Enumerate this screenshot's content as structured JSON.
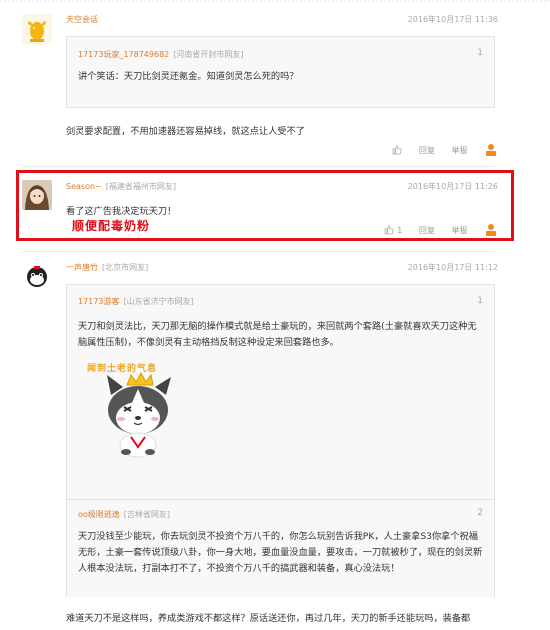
{
  "comments": [
    {
      "username": "天空会话",
      "location": "",
      "time": "2016年10月17日 11:36",
      "quote": {
        "username": "17173玩家_178749682",
        "location": "[河南省开封市网友]",
        "floor": "1",
        "text": "讲个笑话：天刀比剑灵还氪金。知道剑灵怎么死的吗？"
      },
      "text": "剑灵要求配置，不用加速器还容易掉线，就这点让人受不了",
      "actions": {
        "like_count": "",
        "reply": "回复",
        "report": "举报"
      }
    },
    {
      "username": "Season~",
      "location": "[福建省福州市网友]",
      "time": "2016年10月17日 11:26",
      "text": "看了这广告我决定玩天刀！",
      "actions": {
        "like_count": "1",
        "reply": "回复",
        "report": "举报"
      },
      "annotation": "顺便配毒奶粉"
    },
    {
      "username": "一声唐竹",
      "location": "[北京市网友]",
      "time": "2016年10月17日 11:12",
      "quote": {
        "username": "17173游客",
        "location": "[山东省济宁市网友]",
        "floor": "1",
        "text": "天刀和剑灵法比，天刀那无脑的操作模式就是给土豪玩的，来回就两个套路(土豪就喜欢天刀这种无脑属性压制)，不像剑灵有主动格挡反制这种设定来回套路也多。",
        "sticker_caption": "闻到土老的气息"
      },
      "quote2": {
        "username": "oo极限逃逸",
        "location": "[吉林省网友]",
        "floor": "2",
        "text": "天刀没钱至少能玩，你去玩剑灵不投资个万八千的，你怎么玩别告诉我PK，人土豪拿S3你拿个祝福无形，土豪一套传说顶级八卦，你一身大地，要血量没血量，要攻击，一刀就被秒了，现在的剑灵新人根本没法玩，打副本打不了，不投资个万八千的搞武器和装备，真心没法玩！"
      },
      "text": "难道天刀不是这样吗，养成类游戏不都这样？原话送还你，再过几年，天刀的新手还能玩吗，装备都"
    }
  ],
  "colors": {
    "username": "#e07b27",
    "muted": "#a9a9a9",
    "highlight": "#e0101a",
    "up_button": "#f08a1c"
  }
}
